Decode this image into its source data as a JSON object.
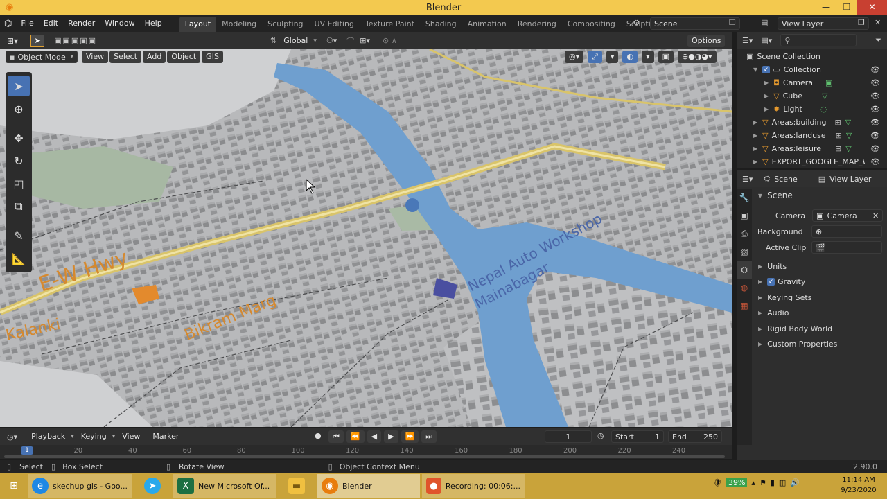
{
  "window": {
    "title": "Blender",
    "minimize": "—",
    "maximize": "❐",
    "close": "✕"
  },
  "menu": {
    "items": [
      "File",
      "Edit",
      "Render",
      "Window",
      "Help"
    ],
    "workspaces": [
      "Layout",
      "Modeling",
      "Sculpting",
      "UV Editing",
      "Texture Paint",
      "Shading",
      "Animation",
      "Rendering",
      "Compositing",
      "Scripting"
    ],
    "active_workspace": "Layout",
    "add_workspace": "+",
    "scene_label": "Scene",
    "view_layer_label": "View Layer"
  },
  "viewport": {
    "transform_orientation": "Global",
    "options_label": "Options",
    "mode": "Object Mode",
    "header_menus": [
      "View",
      "Select",
      "Add",
      "Object",
      "GIS"
    ],
    "map_labels": [
      "E-W Hwy",
      "Nepal Auto Workshop",
      "Mainabagar",
      "Bikram Marg",
      "Kalanki"
    ]
  },
  "outliner": {
    "root": "Scene Collection",
    "collection": "Collection",
    "items": [
      {
        "name": "Camera",
        "indent": 2
      },
      {
        "name": "Cube",
        "indent": 2
      },
      {
        "name": "Light",
        "indent": 2
      },
      {
        "name": "Areas:building",
        "indent": 1
      },
      {
        "name": "Areas:landuse",
        "indent": 1
      },
      {
        "name": "Areas:leisure",
        "indent": 1
      },
      {
        "name": "EXPORT_GOOGLE_MAP_WM",
        "indent": 1
      }
    ]
  },
  "properties": {
    "context_scene": "Scene",
    "context_view_layer": "View Layer",
    "panel_title": "Scene",
    "camera_label": "Camera",
    "camera_value": "Camera",
    "background_label": "Background ...",
    "active_clip_label": "Active Clip",
    "sections": [
      "Units",
      "Gravity",
      "Keying Sets",
      "Audio",
      "Rigid Body World",
      "Custom Properties"
    ]
  },
  "timeline": {
    "menus": [
      "Playback",
      "Keying",
      "View",
      "Marker"
    ],
    "current_frame": "1",
    "start_label": "Start",
    "start_value": "1",
    "end_label": "End",
    "end_value": "250",
    "ruler": [
      "1",
      "20",
      "40",
      "60",
      "80",
      "100",
      "120",
      "140",
      "160",
      "180",
      "200",
      "220",
      "240"
    ]
  },
  "statusbar": {
    "select": "Select",
    "box_select": "Box Select",
    "rotate_view": "Rotate View",
    "context_menu": "Object Context Menu",
    "version": "2.90.0"
  },
  "taskbar": {
    "items": [
      {
        "label": "skechup gis - Goo...",
        "icon": "edge-icon",
        "color": "#1e88e5"
      },
      {
        "label": "",
        "icon": "telegram-icon",
        "color": "#29a9eb"
      },
      {
        "label": "New Microsoft Of...",
        "icon": "excel-icon",
        "color": "#1d6f42"
      },
      {
        "label": "",
        "icon": "folder-icon",
        "color": "#f0c040"
      },
      {
        "label": "Blender",
        "icon": "blender-icon",
        "color": "#e87d0d"
      },
      {
        "label": "Recording: 00:06:...",
        "icon": "recording-icon",
        "color": "#e0542b"
      }
    ],
    "battery": "39%",
    "time": "11:14 AM",
    "date": "9/23/2020"
  },
  "colors": {
    "accent": "#4772b3",
    "titlebar": "#f3c94f",
    "taskbar": "#c9a33a",
    "river": "#6f9fcf",
    "road": "#d9c46a"
  }
}
